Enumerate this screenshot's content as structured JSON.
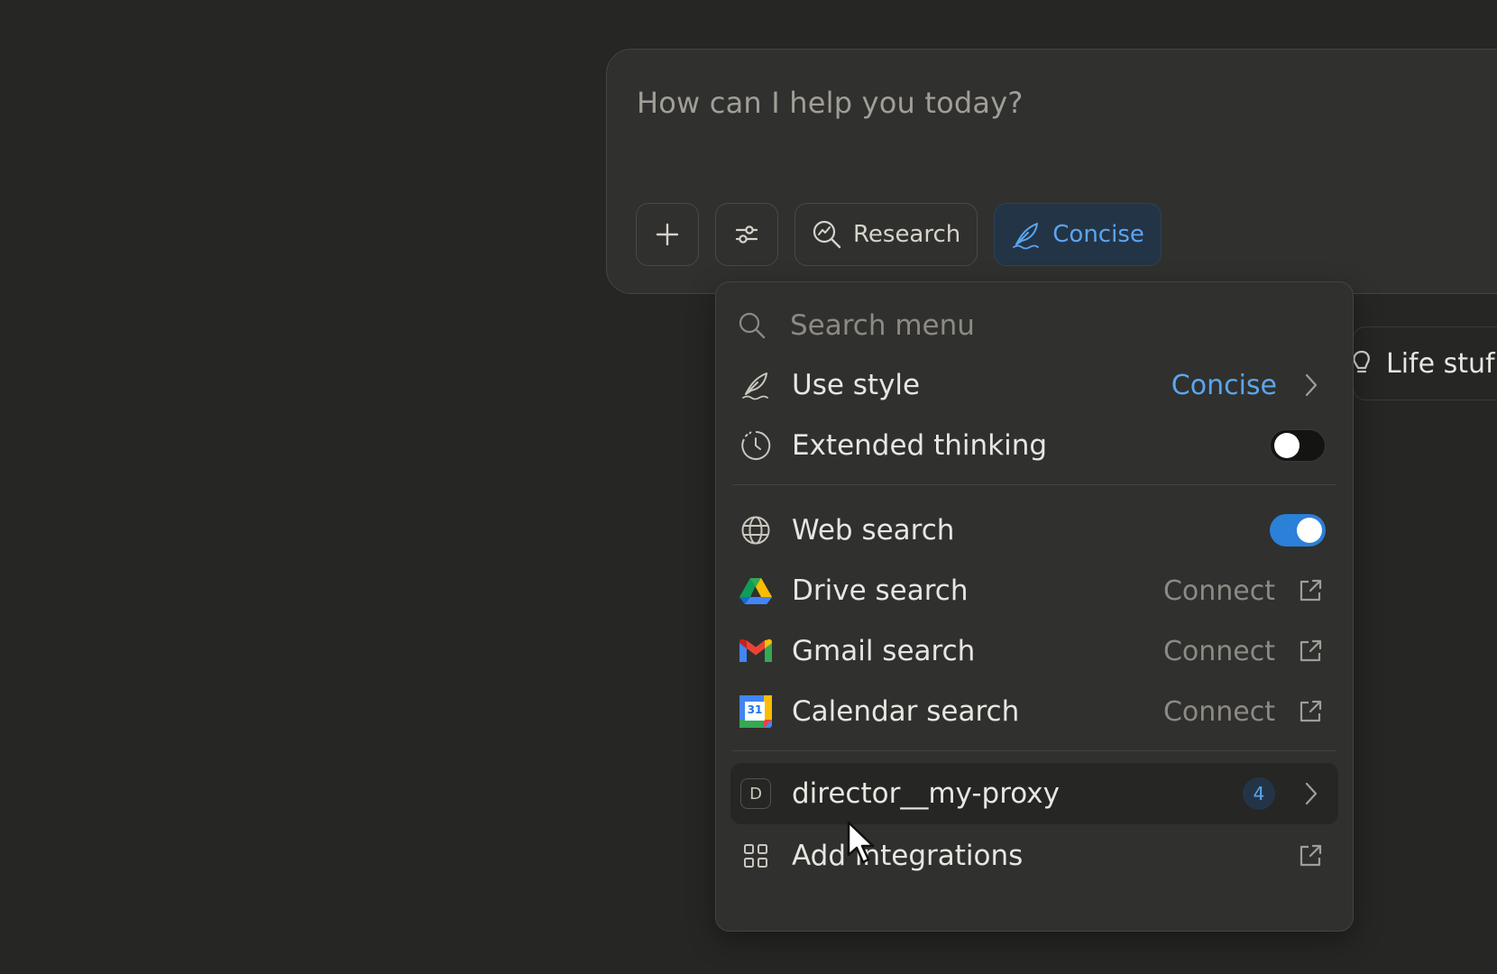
{
  "composer": {
    "placeholder": "How can I help you today?",
    "toolbar": {
      "add_icon": "plus-icon",
      "tools_icon": "sliders-icon",
      "research_label": "Research",
      "style_label": "Concise"
    }
  },
  "side_chip": {
    "label": "Life stuf",
    "icon": "lightbulb-icon"
  },
  "menu": {
    "search_placeholder": "Search menu",
    "items": [
      {
        "label": "Use style",
        "value": "Concise",
        "icon": "feather-icon"
      },
      {
        "label": "Extended thinking",
        "icon": "clock-icon",
        "toggle": false
      },
      {
        "label": "Web search",
        "icon": "globe-icon",
        "toggle": true
      },
      {
        "label": "Drive search",
        "icon": "google-drive-icon",
        "action": "Connect"
      },
      {
        "label": "Gmail search",
        "icon": "gmail-icon",
        "action": "Connect"
      },
      {
        "label": "Calendar search",
        "icon": "google-calendar-icon",
        "action": "Connect",
        "calendar_day": "31"
      },
      {
        "label": "director__my-proxy",
        "badge_letter": "D",
        "count": "4"
      },
      {
        "label": "Add integrations",
        "icon": "grid-icon"
      }
    ]
  },
  "colors": {
    "background": "#262624",
    "panel": "#30302e",
    "accent": "#5aa6ef",
    "toggle_on": "#2b80d8"
  }
}
